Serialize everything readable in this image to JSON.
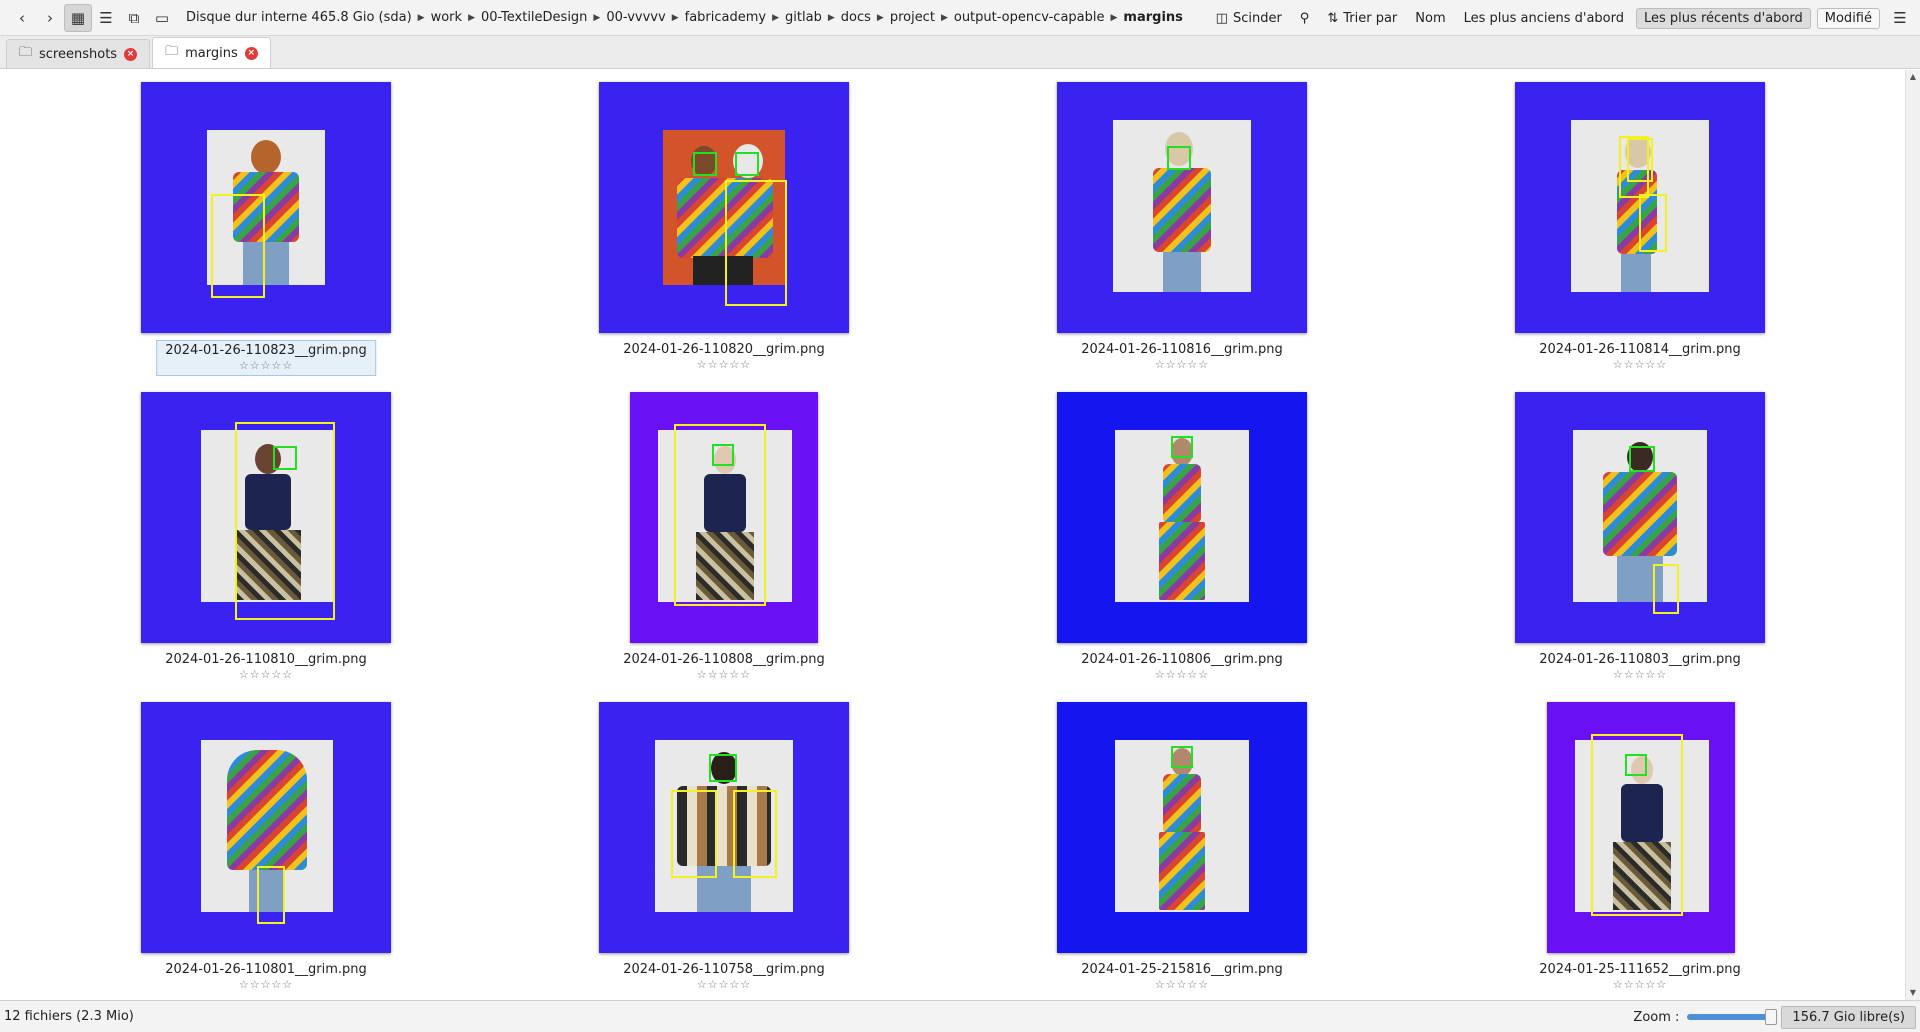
{
  "toolbar": {
    "breadcrumbs": [
      "Disque dur interne 465.8 Gio (sda)",
      "work",
      "00-TextileDesign",
      "00-vvvvv",
      "fabricademy",
      "gitlab",
      "docs",
      "project",
      "output-opencv-capable",
      "margins"
    ],
    "split_label": "Scinder",
    "sort_label": "Trier par",
    "sort_name": "Nom",
    "sort_oldest": "Les plus anciens d'abord",
    "sort_newest": "Les plus récents d'abord",
    "sort_modified": "Modifié"
  },
  "tabs": [
    {
      "label": "screenshots",
      "active": false
    },
    {
      "label": "margins",
      "active": true
    }
  ],
  "files": [
    {
      "name": "2024-01-26-110823__grim.png",
      "rating": "☆☆☆☆☆",
      "selected": true
    },
    {
      "name": "2024-01-26-110820__grim.png",
      "rating": "☆☆☆☆☆"
    },
    {
      "name": "2024-01-26-110816__grim.png",
      "rating": "☆☆☆☆☆"
    },
    {
      "name": "2024-01-26-110814__grim.png",
      "rating": "☆☆☆☆☆"
    },
    {
      "name": "2024-01-26-110810__grim.png",
      "rating": "☆☆☆☆☆"
    },
    {
      "name": "2024-01-26-110808__grim.png",
      "rating": "☆☆☆☆☆"
    },
    {
      "name": "2024-01-26-110806__grim.png",
      "rating": "☆☆☆☆☆"
    },
    {
      "name": "2024-01-26-110803__grim.png",
      "rating": "☆☆☆☆☆"
    },
    {
      "name": "2024-01-26-110801__grim.png",
      "rating": "☆☆☆☆☆"
    },
    {
      "name": "2024-01-26-110758__grim.png",
      "rating": "☆☆☆☆☆"
    },
    {
      "name": "2024-01-25-215816__grim.png",
      "rating": "☆☆☆☆☆"
    },
    {
      "name": "2024-01-25-111652__grim.png",
      "rating": "☆☆☆☆☆"
    }
  ],
  "colors": {
    "margin_blue": "#3a22f0",
    "margin_deep_blue": "#1515ef",
    "margin_violet": "#6a10f5",
    "face_box": "#22e022",
    "body_box": "#f2f222"
  },
  "status": {
    "file_count": "12 fichiers (2.3 Mio)",
    "zoom_label": "Zoom :",
    "free_space": "156.7 Gio libre(s)"
  }
}
